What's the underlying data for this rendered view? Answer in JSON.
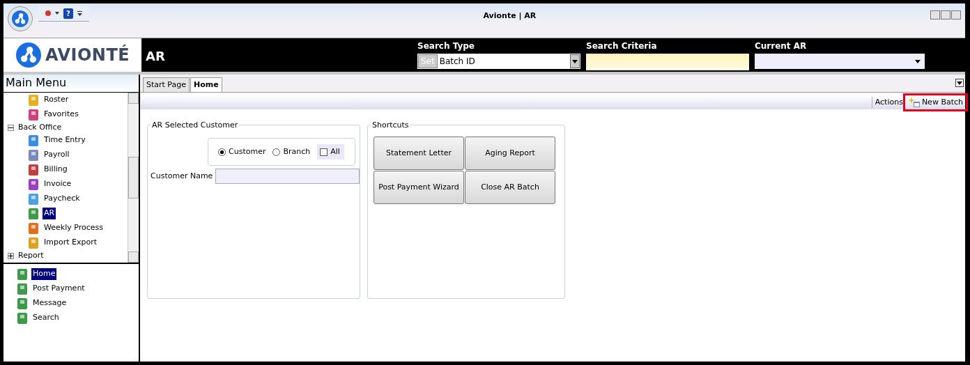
{
  "window": {
    "title": "Avionte | AR",
    "help_glyph": "?"
  },
  "header": {
    "logo_text": "AVIONTÉ",
    "app_title": "AR",
    "search_type": {
      "label": "Search Type",
      "button": "Set",
      "value": "Batch ID"
    },
    "search_criteria": {
      "label": "Search Criteria"
    },
    "current_ar": {
      "label": "Current AR"
    }
  },
  "sidebar": {
    "title": "Main Menu",
    "tree": [
      {
        "children": [
          {
            "label": "Roster",
            "selected": false
          },
          {
            "label": "Favorites",
            "selected": false
          }
        ]
      },
      {
        "label": "Back Office",
        "expanded": true,
        "children": [
          {
            "label": "Time Entry",
            "selected": false
          },
          {
            "label": "Payroll",
            "selected": false
          },
          {
            "label": "Billing",
            "selected": false
          },
          {
            "label": "Invoice",
            "selected": false
          },
          {
            "label": "Paycheck",
            "selected": false
          },
          {
            "label": "AR",
            "selected": true
          },
          {
            "label": "Weekly Process",
            "selected": false
          },
          {
            "label": "Import Export",
            "selected": false
          }
        ]
      },
      {
        "label": "Report",
        "expanded": false
      }
    ],
    "subtree": [
      {
        "label": "Home",
        "selected": true
      },
      {
        "label": "Post Payment",
        "selected": false
      },
      {
        "label": "Message",
        "selected": false
      },
      {
        "label": "Search",
        "selected": false
      }
    ]
  },
  "tabs": [
    {
      "label": "Start Page",
      "selected": false
    },
    {
      "label": "Home",
      "selected": true
    }
  ],
  "toolbar": {
    "actions_label": "Actions",
    "new_batch": {
      "label": "New Batch",
      "highlighted": true
    }
  },
  "customer_panel": {
    "title": "AR Selected Customer",
    "options": [
      {
        "kind": "radio",
        "label": "Customer",
        "selected": true
      },
      {
        "kind": "radio",
        "label": "Branch",
        "selected": false
      },
      {
        "kind": "checkbox",
        "label": "All",
        "checked": false
      }
    ],
    "field_label": "Customer Name"
  },
  "shortcuts": {
    "title": "Shortcuts",
    "buttons": [
      "Statement Letter",
      "Aging Report",
      "Post Payment Wizard",
      "Close AR Batch"
    ]
  }
}
